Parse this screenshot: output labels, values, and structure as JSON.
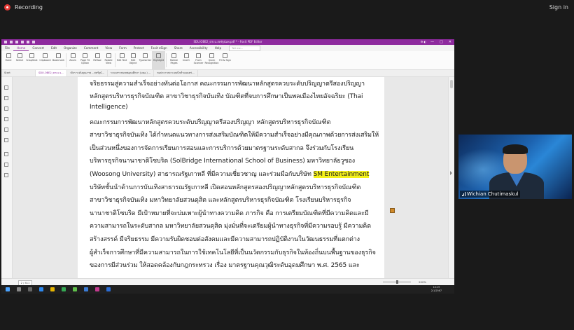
{
  "meeting": {
    "recording_label": "Recording",
    "signin_label": "Sign in",
    "participant_name": "Wichian Chutimaskul"
  },
  "window": {
    "title": "SDU.OBE2_sm.u.สหรัฐนัมพ.pdf * - Foxit PDF Editor",
    "controls": [
      "—",
      "□",
      "✕"
    ]
  },
  "menubar": {
    "items": [
      "File",
      "Home",
      "Convert",
      "Edit",
      "Organize",
      "Comment",
      "View",
      "Form",
      "Protect",
      "Foxit eSign",
      "Share",
      "Accessibility",
      "Help"
    ],
    "active": "Home",
    "tell_me": "Tell me..."
  },
  "ribbon": {
    "buttons": [
      "Hand",
      "Select",
      "SnapShot",
      "Clipboard",
      "Bookmark",
      "Zoom",
      "Page Fit Option",
      "Reflow",
      "Rotate View",
      "Edit Text",
      "Edit Object",
      "Typewriter",
      "Highlight",
      "Rotate Pages",
      "Insert",
      "From Scanner",
      "Quick Recognition",
      "Fill & Sign"
    ]
  },
  "tabs": [
    {
      "label": "Start"
    },
    {
      "label": "SDU.OBE2_sm.u.s..."
    },
    {
      "label": "วจิจร ระดับคุณภาพ ...สหรัฐนั..."
    },
    {
      "label": "ระบบสารสนเทศอุดมศึกษา (มคอ.) ..."
    },
    {
      "label": "ขอประกาศจาะเลยนีกต่ำเผยแพร่..."
    }
  ],
  "document": {
    "lines": [
      {
        "text": "จริยธรรมสู่ความสำเร็จอย่างทันต่อโอกาส คณะกรรมการพัฒนาหลักสูตรควบระดับปริญญาตรีสองปริญญา"
      },
      {
        "text": "หลักสูตรบริหารธุรกิจบัณฑิต สาขาวิชาธุรกิจบันเทิง บัณฑิตที่จบการศึกษาเป็นพลเมืองไทยอัจฉริยะ (Thai"
      },
      {
        "text": "Intelligence)"
      },
      {
        "text": "        คณะกรรมการพัฒนาหลักสูตรควบระดับปริญญาตรีสองปริญญา หลักสูตรบริหารธุรกิจบัณฑิต"
      },
      {
        "text": "สาขาวิชาธุรกิจบันเทิง ได้กำหนดแนวทางการส่งเสริมบัณฑิตให้มีความสำเร็จอย่างมีคุณภาพด้วยการส่งเสริมให้"
      },
      {
        "text": "เป็นส่วนหนึ่งของการจัดการเรียนการสอนและการบริการด้วยมาตรฐานระดับสากล จึงร่วมกับโรงเรียน"
      },
      {
        "text": "บริหารธุรกิจนานาชาติโซบริด (SolBridge International School of Business) มหาวิทยาลัยวูซอง"
      },
      {
        "text": "(Woosong University) สาธารณรัฐเกาหลี ที่มีความเชี่ยวชาญ และร่วมมือกับบริษัท ",
        "highlight": "SM Entertainment"
      },
      {
        "text": "บริษัทชั้นนำด้านการบันเทิงสาธารณรัฐเกาหลี เปิดสอนหลักสูตรสองปริญญาหลักสูตรบริหารธุรกิจบัณฑิต"
      },
      {
        "text": "สาขาวิชาธุรกิจบันเทิง มหาวิทยาลัยสวนดุสิต และหลักสูตรบริหารธุรกิจบัณฑิต โรงเรียนบริหารธุรกิจ"
      },
      {
        "text": "นานาชาติโซบริด มีเป้าหมายที่จะบ่มเพาะผู้นำทางความคิด ภารกิจ คือ การเตรียมบัณฑิตที่มีความคิดและมี"
      },
      {
        "text": "ความสามารถในระดับสากล มหาวิทยาลัยสวนดุสิต มุ่งมั่นที่จะเตรียมผู้นำทางธุรกิจที่มีความรอบรู้ มีความคิด"
      },
      {
        "text": "สร้างสรรค์ มีจริยธรรม มีความรับผิดชอบต่อสังคมและมีความสามารถปฏิบัติงานในวัฒนธรรมที่แตกต่าง"
      },
      {
        "text": "ผู้สำเร็จการศึกษาที่มีความสามารถในการใช้เทคโนโลยีที่เป็นนวัตกรรมกับธุรกิจในท้องถิ่นบนพื้นฐานของธุรกิจ"
      },
      {
        "text": "ของการมีส่วนร่วม ให้สอดคล้องกับกฎกระทรวง เรื่อง มาตรฐานคุณวุฒิระดับอุดมศึกษา พ.ศ. 2565 และ"
      }
    ]
  },
  "statusbar": {
    "page_indicator": "2 / 411",
    "zoom": "200%"
  },
  "taskbar": {
    "time": "14:19",
    "date": "2/1/2567"
  }
}
